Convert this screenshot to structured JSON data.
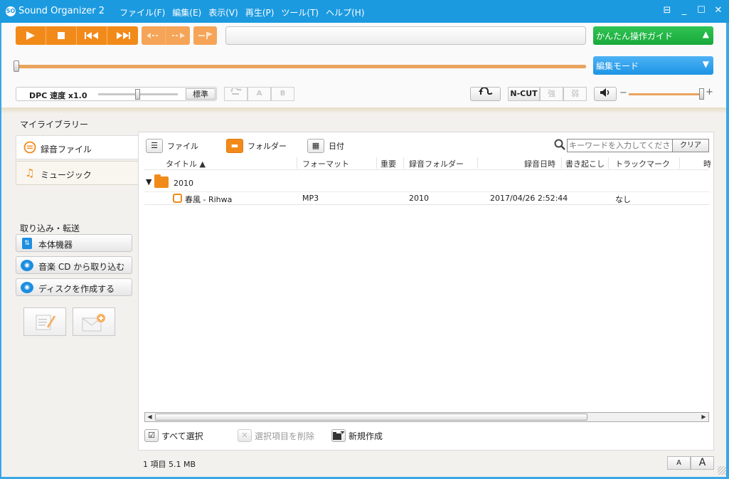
{
  "app": {
    "logo_text": "SO",
    "title": "Sound Organizer 2",
    "menu": [
      "ファイル(F)",
      "編集(E)",
      "表示(V)",
      "再生(P)",
      "ツール(T)",
      "ヘルプ(H)"
    ]
  },
  "window_controls": [
    "⊟",
    "_",
    "☐",
    "✕"
  ],
  "guide": {
    "label": "かんたん操作ガイド",
    "caret": "▲"
  },
  "mode": {
    "label": "編集モード",
    "caret": "▼"
  },
  "seek": {
    "position": 0.0
  },
  "dpc": {
    "label": "DPC 速度  x1.0",
    "standard": "標準",
    "speed_fraction": 0.5
  },
  "ab": {
    "a": "A",
    "b": "B"
  },
  "ncut": {
    "label": "N-CUT",
    "strong": "強",
    "weak": "弱"
  },
  "volume": {
    "minus": "−",
    "plus": "+",
    "level": 0.98
  },
  "sidebar": {
    "library_title": "マイライブラリー",
    "tabs": [
      {
        "label": "録音ファイル",
        "active": true
      },
      {
        "label": "ミュージック",
        "active": false
      }
    ],
    "transfer_title": "取り込み・転送",
    "buttons": [
      {
        "label": "本体機器"
      },
      {
        "label": "音楽 CD から取り込む"
      },
      {
        "label": "ディスクを作成する"
      }
    ]
  },
  "content": {
    "views": [
      "ファイル",
      "フォルダー",
      "日付"
    ],
    "active_view": "フォルダー",
    "search": {
      "placeholder": "キーワードを入力してください",
      "clear": "クリア"
    },
    "columns": [
      "タイトル ▲",
      "フォーマット",
      "重要",
      "録音フォルダー",
      "録音日時",
      "書き起こし",
      "トラックマーク",
      "時"
    ],
    "folder": {
      "toggle": "▼",
      "name": "2010"
    },
    "rows": [
      {
        "title": "春風 - Rihwa",
        "format": "MP3",
        "folder": "2010",
        "datetime": "2017/04/26 2:52:44",
        "trackmark": "なし"
      }
    ],
    "actions": {
      "select_all": "すべて選択",
      "delete_selected": "選択項目を削除",
      "new": "新規作成"
    }
  },
  "status": {
    "text": "1 項目  5.1 MB"
  },
  "font_size": {
    "small": "A",
    "large": "A"
  }
}
